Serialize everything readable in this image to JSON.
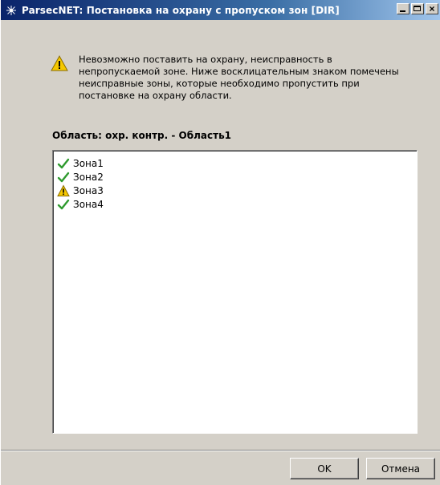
{
  "window": {
    "title": "ParsecNET: Постановка на охрану с пропуском зон [DIR]",
    "buttons": {
      "minimize": "minimize",
      "maximize": "maximize",
      "close": "×"
    }
  },
  "message": "Невозможно поставить на охрану, неисправность в непропускаемой зоне. Ниже восклицательным знаком помечены неисправные зоны, которые необходимо пропустить при постановке на охрану области.",
  "area_label": "Область: охр. контр. - Область1",
  "zones": [
    {
      "label": "Зона1",
      "status": "ok",
      "icon": "check-icon"
    },
    {
      "label": "Зона2",
      "status": "ok",
      "icon": "check-icon"
    },
    {
      "label": "Зона3",
      "status": "fault",
      "icon": "warning-icon"
    },
    {
      "label": "Зона4",
      "status": "ok",
      "icon": "check-icon"
    }
  ],
  "buttons": {
    "ok": "OK",
    "cancel": "Отмена"
  },
  "colors": {
    "title_bar_start": "#0a246a",
    "title_bar_end": "#a6caf0",
    "dialog_bg": "#d4d0c8",
    "check_green": "#2e9a2e",
    "warning_yellow": "#f5c800"
  }
}
